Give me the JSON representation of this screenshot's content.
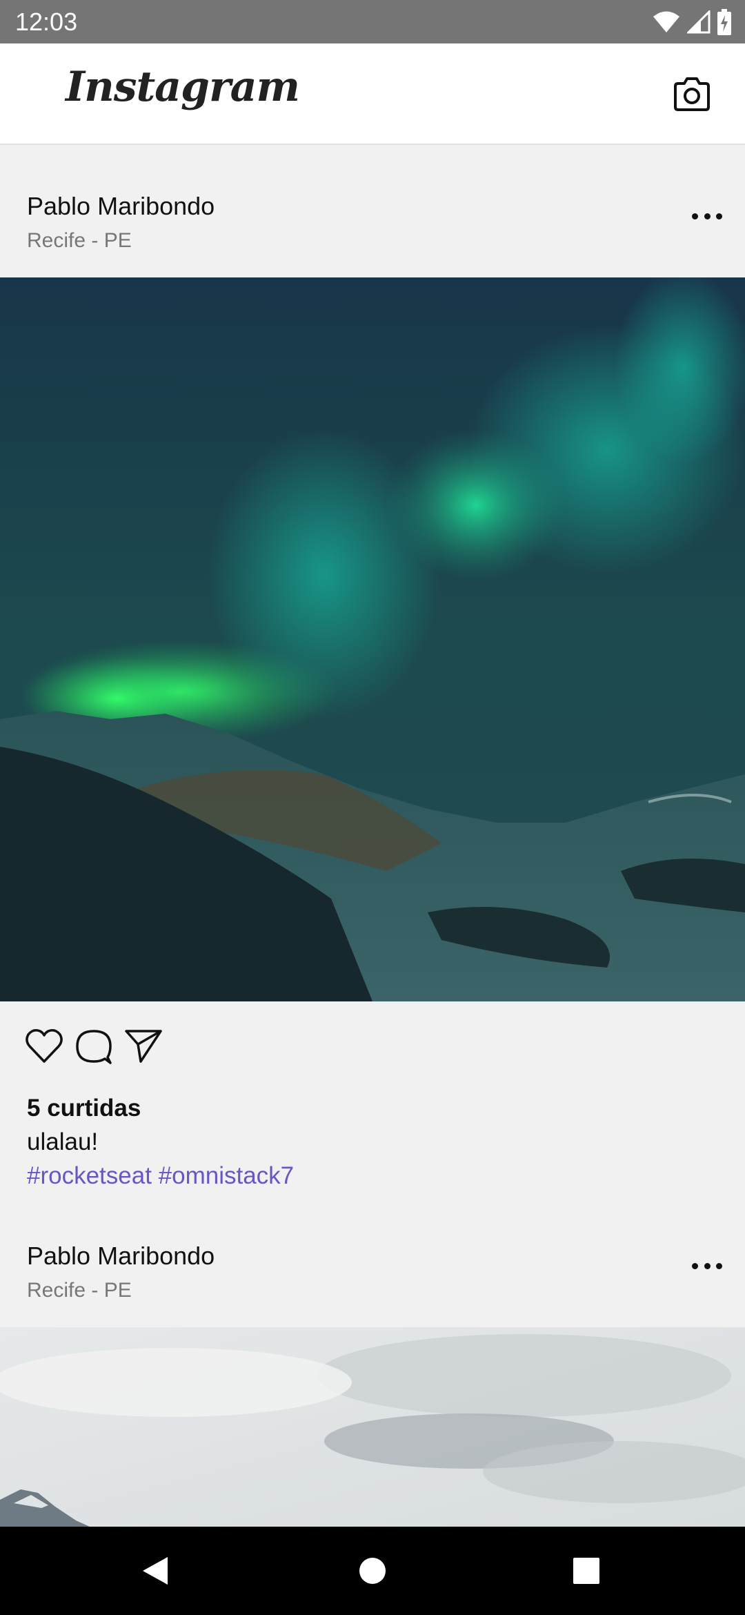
{
  "status_bar": {
    "time": "12:03",
    "icons": [
      "wifi-icon",
      "signal-icon",
      "battery-icon"
    ]
  },
  "header": {
    "logo": "Instagram",
    "camera_icon": "camera-icon"
  },
  "posts": [
    {
      "author": "Pablo Maribondo",
      "place": "Recife - PE",
      "image": "northern lights over snowy mountains",
      "actions": [
        "like-icon",
        "comment-icon",
        "send-icon"
      ],
      "likes": "5 curtidas",
      "description": "ulalau!",
      "hashtags": "#rocketseat #omnistack7"
    },
    {
      "author": "Pablo Maribondo",
      "place": "Recife - PE",
      "image": "cloudy sky over mountain peak"
    }
  ],
  "nav": {
    "buttons": [
      "back-icon",
      "home-icon",
      "recents-icon"
    ]
  },
  "colors": {
    "hashtag": "#6a55c4",
    "status_bar": "#757575",
    "background": "#f1f1f1"
  }
}
